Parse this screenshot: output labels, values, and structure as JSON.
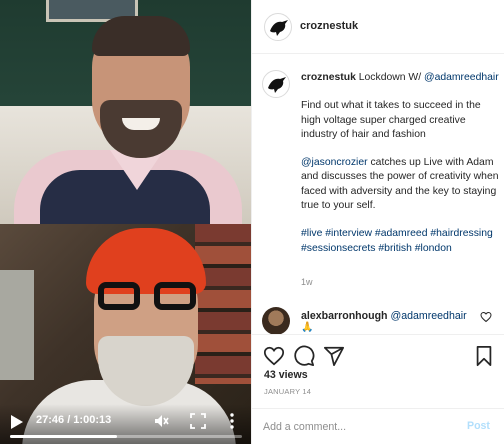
{
  "video": {
    "time_display": "27:46 / 1:00:13",
    "progress": 0.46,
    "controls": {
      "play": "play-icon",
      "mute": "mute-icon",
      "fullscreen": "fullscreen-icon",
      "more": "more-vertical-icon"
    }
  },
  "header": {
    "username": "croznestuk",
    "avatar_icon": "crow-logo-icon"
  },
  "caption": {
    "username": "croznestuk",
    "intro": " Lockdown W/ ",
    "mention1": "@adamreedhair",
    "paragraph1": "Find out what it takes to succeed in the high voltage super charged creative industry of hair and fashion",
    "mention2": "@jasoncrozier",
    "paragraph2_rest": " catches up Live with Adam and discusses the power of creativity when faced with adversity and the key to staying true to your self.",
    "hashtags": "#live #interview #adamreed #hairdressing #sessionsecrets #british #london",
    "time_ago": "1w"
  },
  "comment": {
    "username": "alexbarronhough",
    "mention": "@adamreedhair",
    "emoji": "🙏"
  },
  "actions": {
    "like": "heart-icon",
    "comment": "comment-bubble-icon",
    "share": "paper-plane-icon",
    "save": "bookmark-icon",
    "views": "43 views",
    "date": "JANUARY 14"
  },
  "add_comment": {
    "placeholder": "Add a comment...",
    "post_label": "Post"
  },
  "colors": {
    "link": "#00376b",
    "post_disabled": "#b2dffc",
    "muted": "#8e8e8e"
  }
}
